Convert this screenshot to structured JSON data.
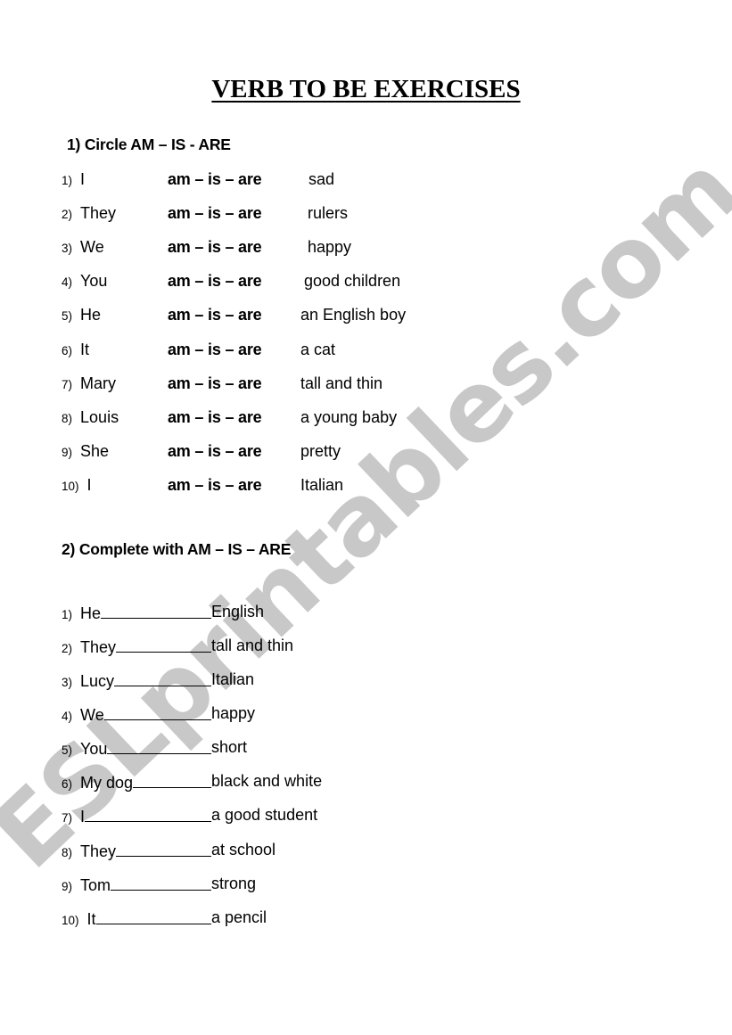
{
  "title": "VERB TO BE EXERCISES",
  "watermark": "ESLprintables.com",
  "exercise1": {
    "heading": "1) Circle AM – IS - ARE",
    "options": "am – is – are",
    "items": [
      {
        "num": "1)",
        "subject": "I",
        "predicate": "sad"
      },
      {
        "num": "2)",
        "subject": "They",
        "predicate": "rulers"
      },
      {
        "num": "3)",
        "subject": "We",
        "predicate": "happy"
      },
      {
        "num": "4)",
        "subject": "You",
        "predicate": "good children"
      },
      {
        "num": "5)",
        "subject": "He",
        "predicate": "an English boy"
      },
      {
        "num": "6)",
        "subject": "It",
        "predicate": "a cat"
      },
      {
        "num": "7)",
        "subject": "Mary",
        "predicate": "tall and thin"
      },
      {
        "num": "8)",
        "subject": "Louis",
        "predicate": "a young baby"
      },
      {
        "num": "9)",
        "subject": "She",
        "predicate": "pretty"
      },
      {
        "num": "10)",
        "subject": "I",
        "predicate": "Italian"
      }
    ]
  },
  "exercise2": {
    "heading": "2) Complete with AM – IS – ARE",
    "items": [
      {
        "num": "1)",
        "subject": "He",
        "predicate": "English"
      },
      {
        "num": "2)",
        "subject": "They",
        "predicate": "tall and thin"
      },
      {
        "num": "3)",
        "subject": "Lucy",
        "predicate": "Italian"
      },
      {
        "num": "4)",
        "subject": "We",
        "predicate": "happy"
      },
      {
        "num": "5)",
        "subject": "You",
        "predicate": "short"
      },
      {
        "num": "6)",
        "subject": "My dog",
        "predicate": "black and white"
      },
      {
        "num": "7)",
        "subject": "I",
        "predicate": "a good student"
      },
      {
        "num": "8)",
        "subject": "They",
        "predicate": "at school"
      },
      {
        "num": "9)",
        "subject": "Tom",
        "predicate": "strong"
      },
      {
        "num": "10)",
        "subject": "It",
        "predicate": "a  pencil"
      }
    ]
  }
}
